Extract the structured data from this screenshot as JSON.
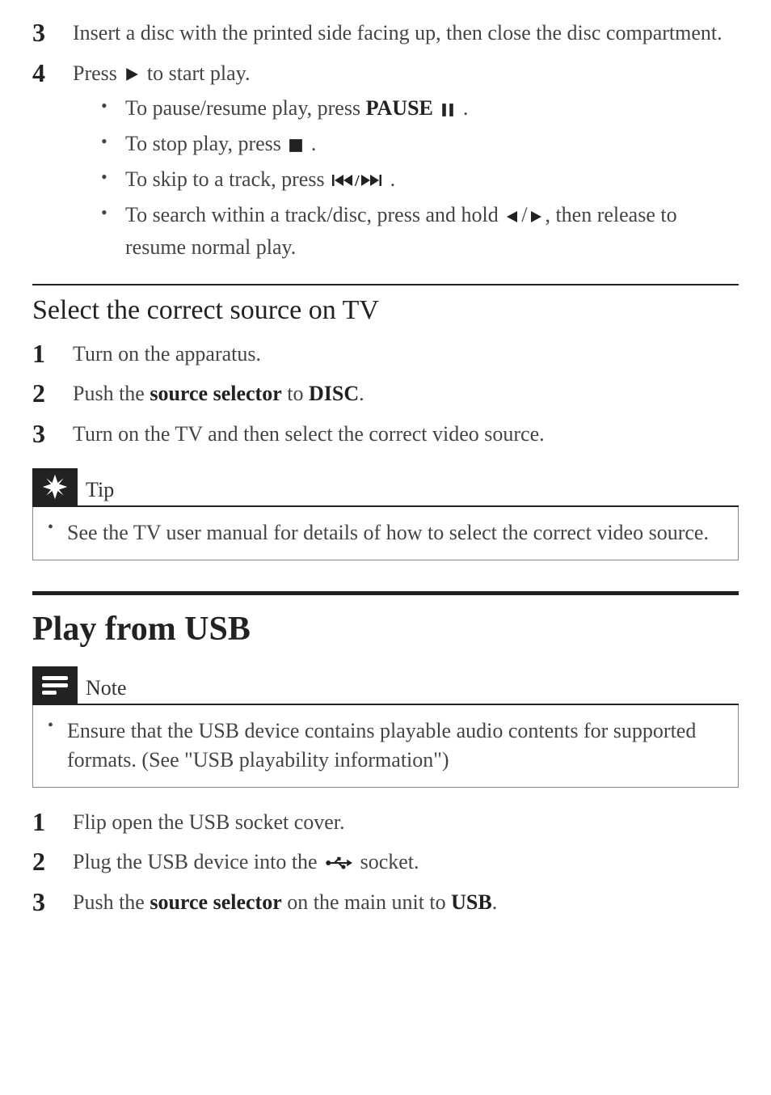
{
  "steps_top": {
    "s3": {
      "num": "3",
      "text": "Insert a disc with the printed side facing up, then close the disc compartment."
    },
    "s4": {
      "num": "4",
      "prefix": "Press ",
      "suffix": " to start play.",
      "bullets": {
        "b1": {
          "prefix": "To pause/resume play, press ",
          "bold": "PAUSE",
          "suffix": " ."
        },
        "b2": {
          "prefix": "To stop play, press ",
          "suffix": " ."
        },
        "b3": {
          "prefix": "To skip to a track, press ",
          "suffix": " ."
        },
        "b4": {
          "prefix": "To search within a track/disc, press and hold ",
          "mid": "/",
          "suffix": ", then release to resume normal play."
        }
      }
    }
  },
  "section1": {
    "title": "Select the correct source on TV",
    "steps": {
      "s1": {
        "num": "1",
        "text": "Turn on the apparatus."
      },
      "s2": {
        "num": "2",
        "t1": "Push the ",
        "bold1": "source selector",
        "t2": " to ",
        "bold2": "DISC",
        "t3": "."
      },
      "s3": {
        "num": "3",
        "text": "Turn on the TV and then select the correct video source."
      }
    }
  },
  "tip": {
    "label": "Tip",
    "text": "See the TV user manual for details of how to select the correct video source."
  },
  "section2": {
    "title": "Play from USB"
  },
  "note": {
    "label": "Note",
    "text": "Ensure that the USB device contains playable audio contents for supported formats. (See \"USB playability information\")"
  },
  "steps_bottom": {
    "s1": {
      "num": "1",
      "text": "Flip open the USB socket cover."
    },
    "s2": {
      "num": "2",
      "t1": "Plug the USB device into the ",
      "t2": " socket."
    },
    "s3": {
      "num": "3",
      "t1": "Push the ",
      "bold1": "source selector",
      "t2": " on the main unit to ",
      "bold2": "USB",
      "t3": "."
    }
  }
}
